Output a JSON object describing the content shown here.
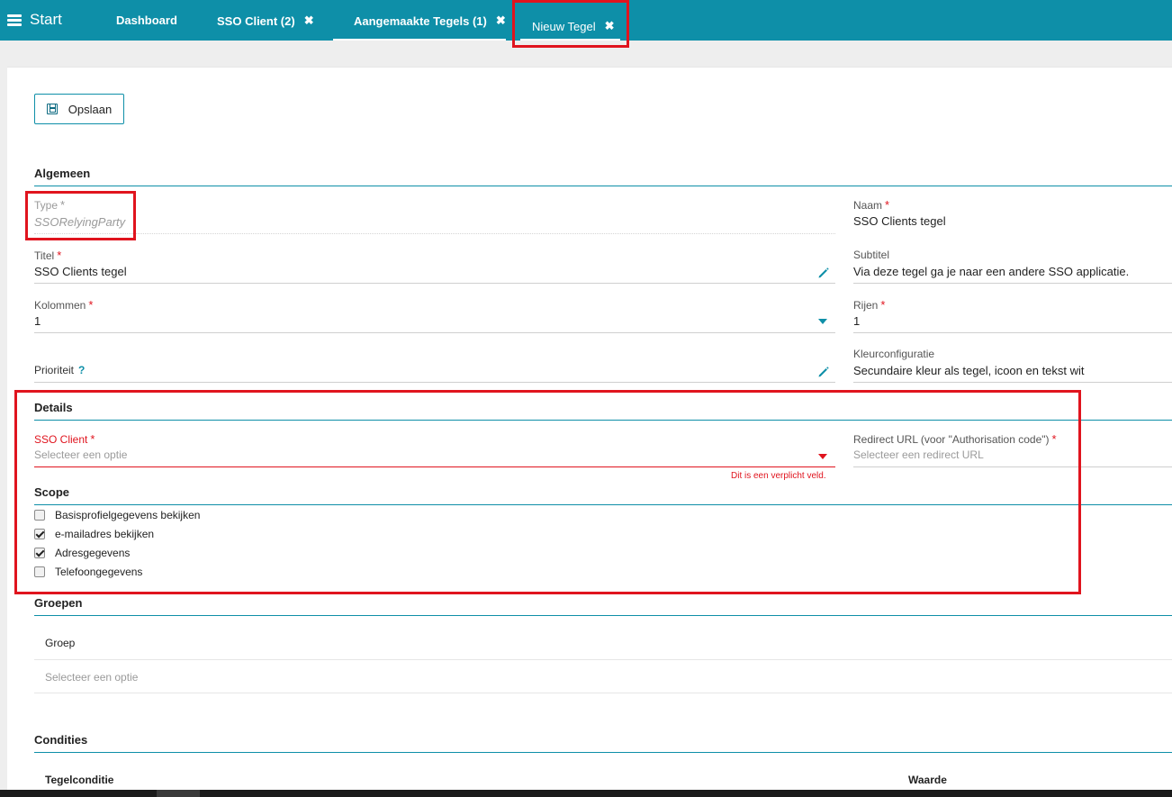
{
  "header": {
    "start_label": "Start",
    "tabs": [
      {
        "label": "Dashboard",
        "closable": false
      },
      {
        "label": "SSO Client (2)",
        "closable": true
      },
      {
        "label": "Aangemaakte Tegels (1)",
        "closable": true
      },
      {
        "label": "Nieuw Tegel",
        "closable": true,
        "active": true
      }
    ],
    "close_glyph": "✖",
    "colors": {
      "bar": "#0e8fa8",
      "highlight": "#e0141e"
    }
  },
  "toolbar": {
    "save_label": "Opslaan",
    "save_icon": "floppy-disk-icon"
  },
  "algemeen": {
    "title": "Algemeen",
    "type_label": "Type",
    "type_value": "SSORelyingParty",
    "naam_label": "Naam",
    "naam_value": "SSO Clients tegel",
    "titel_label": "Titel",
    "titel_value": "SSO Clients tegel",
    "subtitel_label": "Subtitel",
    "subtitel_value": "Via deze tegel ga je naar een andere SSO applicatie.",
    "kolommen_label": "Kolommen",
    "kolommen_value": "1",
    "rijen_label": "Rijen",
    "rijen_value": "1",
    "prioriteit_label": "Prioriteit",
    "prioriteit_help": "?",
    "kleur_label": "Kleurconfiguratie",
    "kleur_value": "Secundaire kleur als tegel, icoon en tekst wit",
    "required_mark": "*"
  },
  "details": {
    "title": "Details",
    "sso_client_label": "SSO Client",
    "sso_client_placeholder": "Selecteer een optie",
    "sso_client_error": "Dit is een verplicht veld.",
    "redirect_label": "Redirect URL (voor \"Authorisation code\")",
    "redirect_placeholder": "Selecteer een redirect URL"
  },
  "scope": {
    "title": "Scope",
    "items": [
      {
        "label": "Basisprofielgegevens bekijken",
        "checked": false
      },
      {
        "label": "e-mailadres bekijken",
        "checked": true
      },
      {
        "label": "Adresgegevens",
        "checked": true
      },
      {
        "label": "Telefoongegevens",
        "checked": false
      }
    ]
  },
  "groepen": {
    "title": "Groepen",
    "column_label": "Groep",
    "placeholder": "Selecteer een optie"
  },
  "condities": {
    "title": "Condities",
    "col_tegelconditie": "Tegelconditie",
    "col_waarde": "Waarde"
  }
}
